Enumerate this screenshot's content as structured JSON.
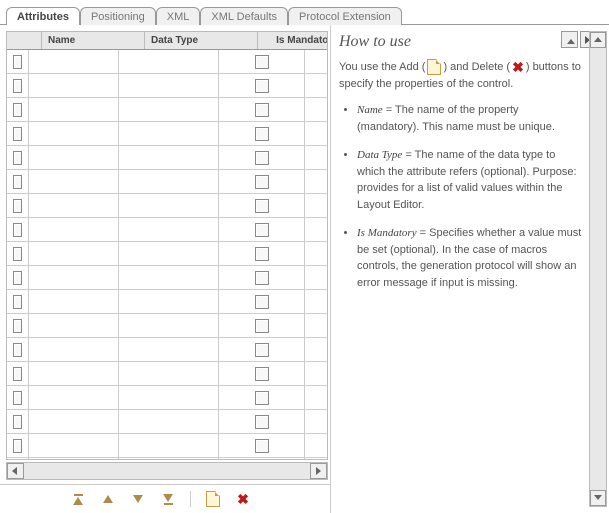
{
  "tabs": [
    "Attributes",
    "Positioning",
    "XML",
    "XML Defaults",
    "Protocol Extension"
  ],
  "active_tab": 0,
  "grid": {
    "columns": [
      "Name",
      "Data Type",
      "Is Mandatory"
    ],
    "row_count": 18
  },
  "toolbar": {
    "move_top": "move-top",
    "move_up": "move-up",
    "move_down": "move-down",
    "move_bottom": "move-bottom",
    "add": "add",
    "delete": "delete"
  },
  "help": {
    "title": "How to use",
    "intro_before": "You use the Add (",
    "intro_mid": ") and Delete (",
    "intro_after": ") buttons to specify the properties of the control.",
    "items": [
      {
        "term": "Name",
        "desc": " = The name of the property (mandatory). This name must be unique."
      },
      {
        "term": "Data Type",
        "desc": " = The name of the data type to which the attribute refers (optional). Purpose: provides for a list of valid values within the Layout Editor."
      },
      {
        "term": "Is Mandatory",
        "desc": " = Specifies whether a value must be set (optional). In the case of macros controls, the generation protocol will show an error message if input is missing."
      }
    ]
  }
}
